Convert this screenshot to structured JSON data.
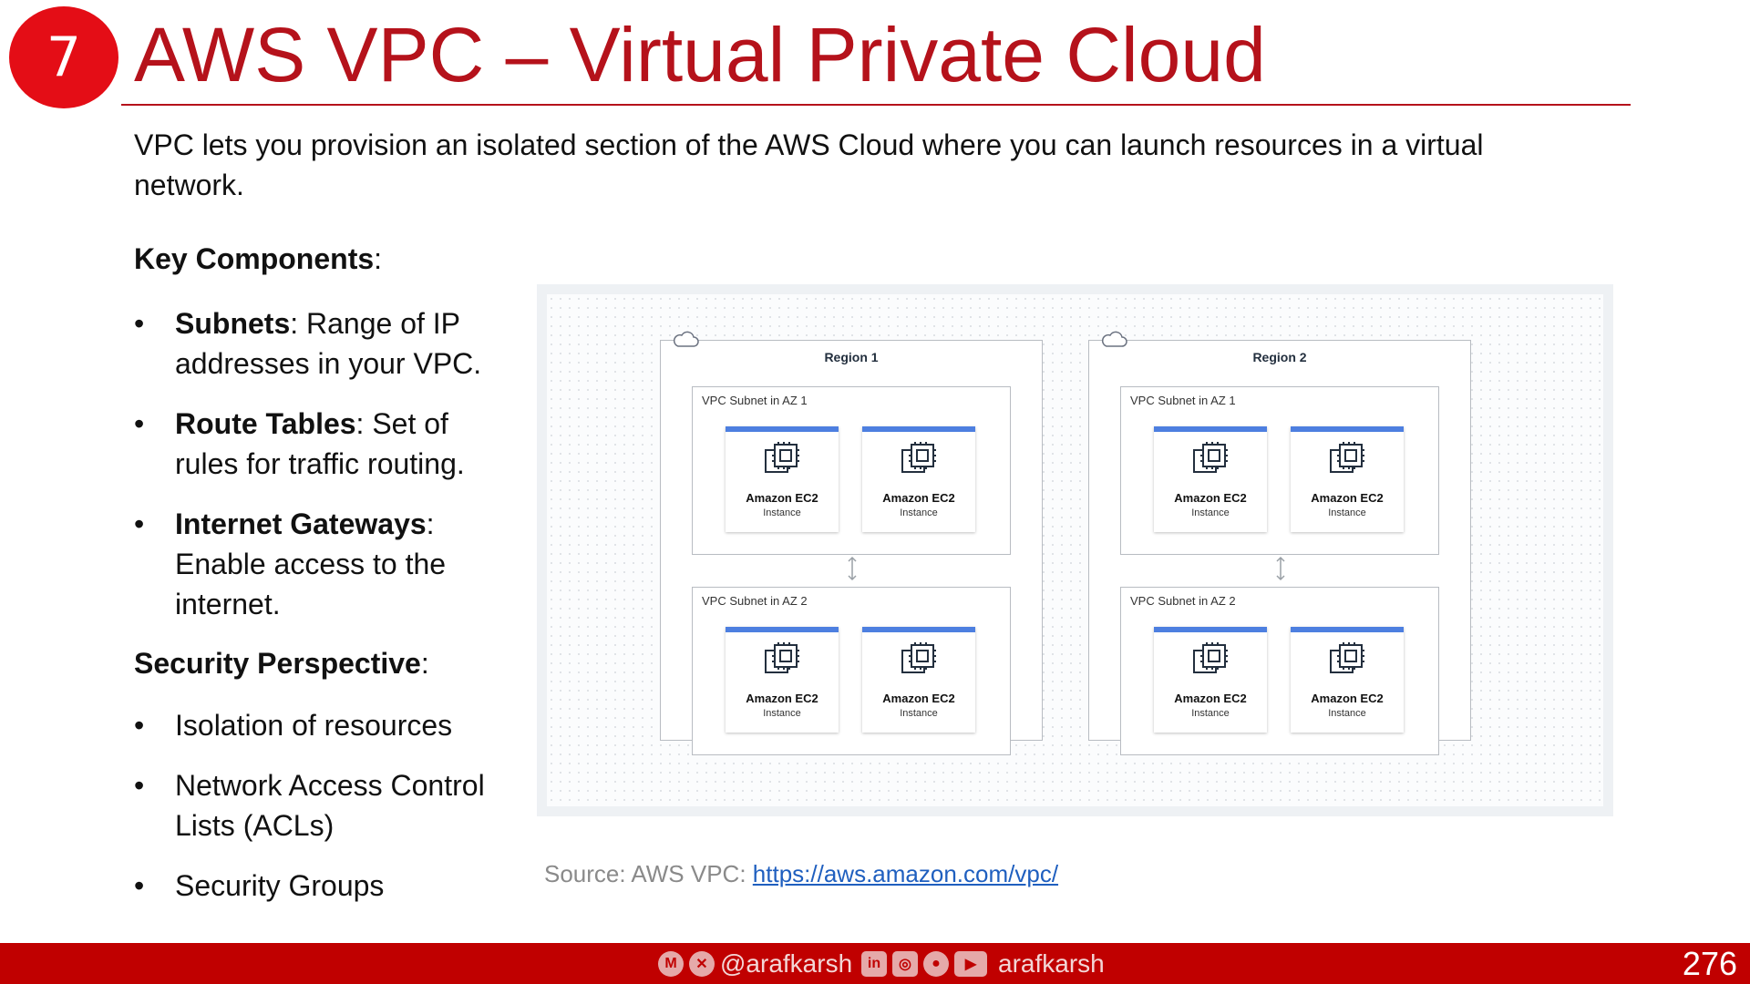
{
  "slide": {
    "badge_number": "7",
    "title": "AWS VPC – Virtual Private Cloud",
    "intro": "VPC lets you provision an isolated section of the AWS Cloud where you can launch resources in a virtual network.",
    "key_components_heading": "Key Components",
    "key_components": [
      {
        "term": "Subnets",
        "desc": ": Range of IP addresses in your VPC."
      },
      {
        "term": "Route Tables",
        "desc": ": Set of rules for traffic routing."
      },
      {
        "term": "Internet Gateways",
        "desc": ": Enable access to the internet."
      }
    ],
    "security_heading": "Security Perspective",
    "security_items": [
      "Isolation of resources",
      "Network Access Control Lists (ACLs)",
      "Security Groups"
    ],
    "bullet": "•",
    "colon": ":",
    "source_prefix": "Source: AWS VPC: ",
    "source_link": "https://aws.amazon.com/vpc/"
  },
  "diagram": {
    "regions": [
      {
        "title": "Region 1",
        "subnets": [
          {
            "label": "VPC Subnet in AZ 1",
            "instances": [
              {
                "name": "Amazon EC2",
                "type": "Instance"
              },
              {
                "name": "Amazon EC2",
                "type": "Instance"
              }
            ]
          },
          {
            "label": "VPC Subnet in AZ 2",
            "instances": [
              {
                "name": "Amazon EC2",
                "type": "Instance"
              },
              {
                "name": "Amazon EC2",
                "type": "Instance"
              }
            ]
          }
        ]
      },
      {
        "title": "Region 2",
        "subnets": [
          {
            "label": "VPC Subnet in AZ 1",
            "instances": [
              {
                "name": "Amazon EC2",
                "type": "Instance"
              },
              {
                "name": "Amazon EC2",
                "type": "Instance"
              }
            ]
          },
          {
            "label": "VPC Subnet in AZ 2",
            "instances": [
              {
                "name": "Amazon EC2",
                "type": "Instance"
              },
              {
                "name": "Amazon EC2",
                "type": "Instance"
              }
            ]
          }
        ]
      }
    ],
    "card_accent_color": "#4d7fe0"
  },
  "footer": {
    "handle_left": "@arafkarsh",
    "handle_right": "arafkarsh",
    "page_number": "276",
    "icons_left": [
      "medium-icon",
      "x-icon"
    ],
    "icons_right": [
      "linkedin-icon",
      "instagram-icon",
      "github-icon",
      "youtube-icon"
    ],
    "bar_color": "#c00000"
  },
  "colors": {
    "accent_red": "#b5121b",
    "badge_red": "#e40d16"
  }
}
